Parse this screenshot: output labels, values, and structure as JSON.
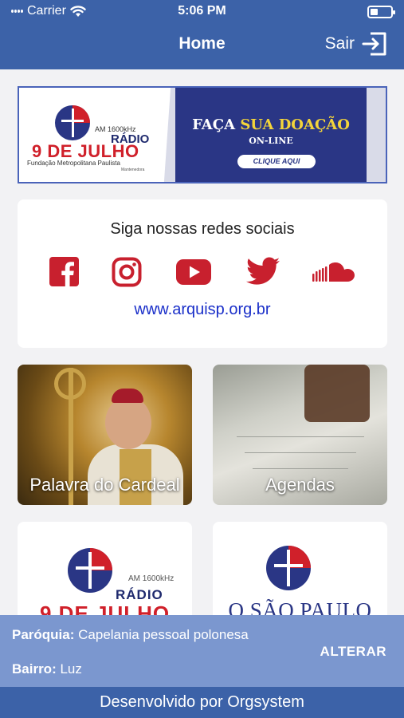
{
  "status_bar": {
    "carrier": "Carrier",
    "time": "5:06 PM"
  },
  "header": {
    "title": "Home",
    "logout_label": "Sair"
  },
  "banner": {
    "am": "AM 1600kHz",
    "radio": "RÁDIO",
    "station": "9 DE JULHO",
    "foundation": "Fundação Metropolitana Paulista",
    "maintainer": "Mantenedora",
    "headline_white": "FAÇA ",
    "headline_yellow": "SUA DOAÇÃO",
    "subline": "ON-LINE",
    "cta": "CLIQUE AQUI"
  },
  "social": {
    "title": "Siga nossas redes sociais",
    "icons": [
      "facebook-icon",
      "instagram-icon",
      "youtube-icon",
      "twitter-icon",
      "soundcloud-icon"
    ],
    "link": "www.arquisp.org.br",
    "icon_color": "#c8202e",
    "link_color": "#1a2fc9"
  },
  "tiles": [
    {
      "label": "Palavra do Cardeal"
    },
    {
      "label": "Agendas"
    },
    {
      "am": "AM 1600kHz",
      "radio": "RÁDIO",
      "station": "9 DE JULHO"
    },
    {
      "title": "O SÃO PAULO"
    }
  ],
  "parish": {
    "parish_label": "Paróquia:",
    "parish_value": "Capelania pessoal polonesa",
    "district_label": "Bairro:",
    "district_value": "Luz",
    "change_button": "ALTERAR"
  },
  "footer": {
    "text": "Desenvolvido por Orgsystem"
  },
  "colors": {
    "primary": "#3c62a8",
    "panel": "#7b97cf",
    "background": "#f2f2f4"
  }
}
